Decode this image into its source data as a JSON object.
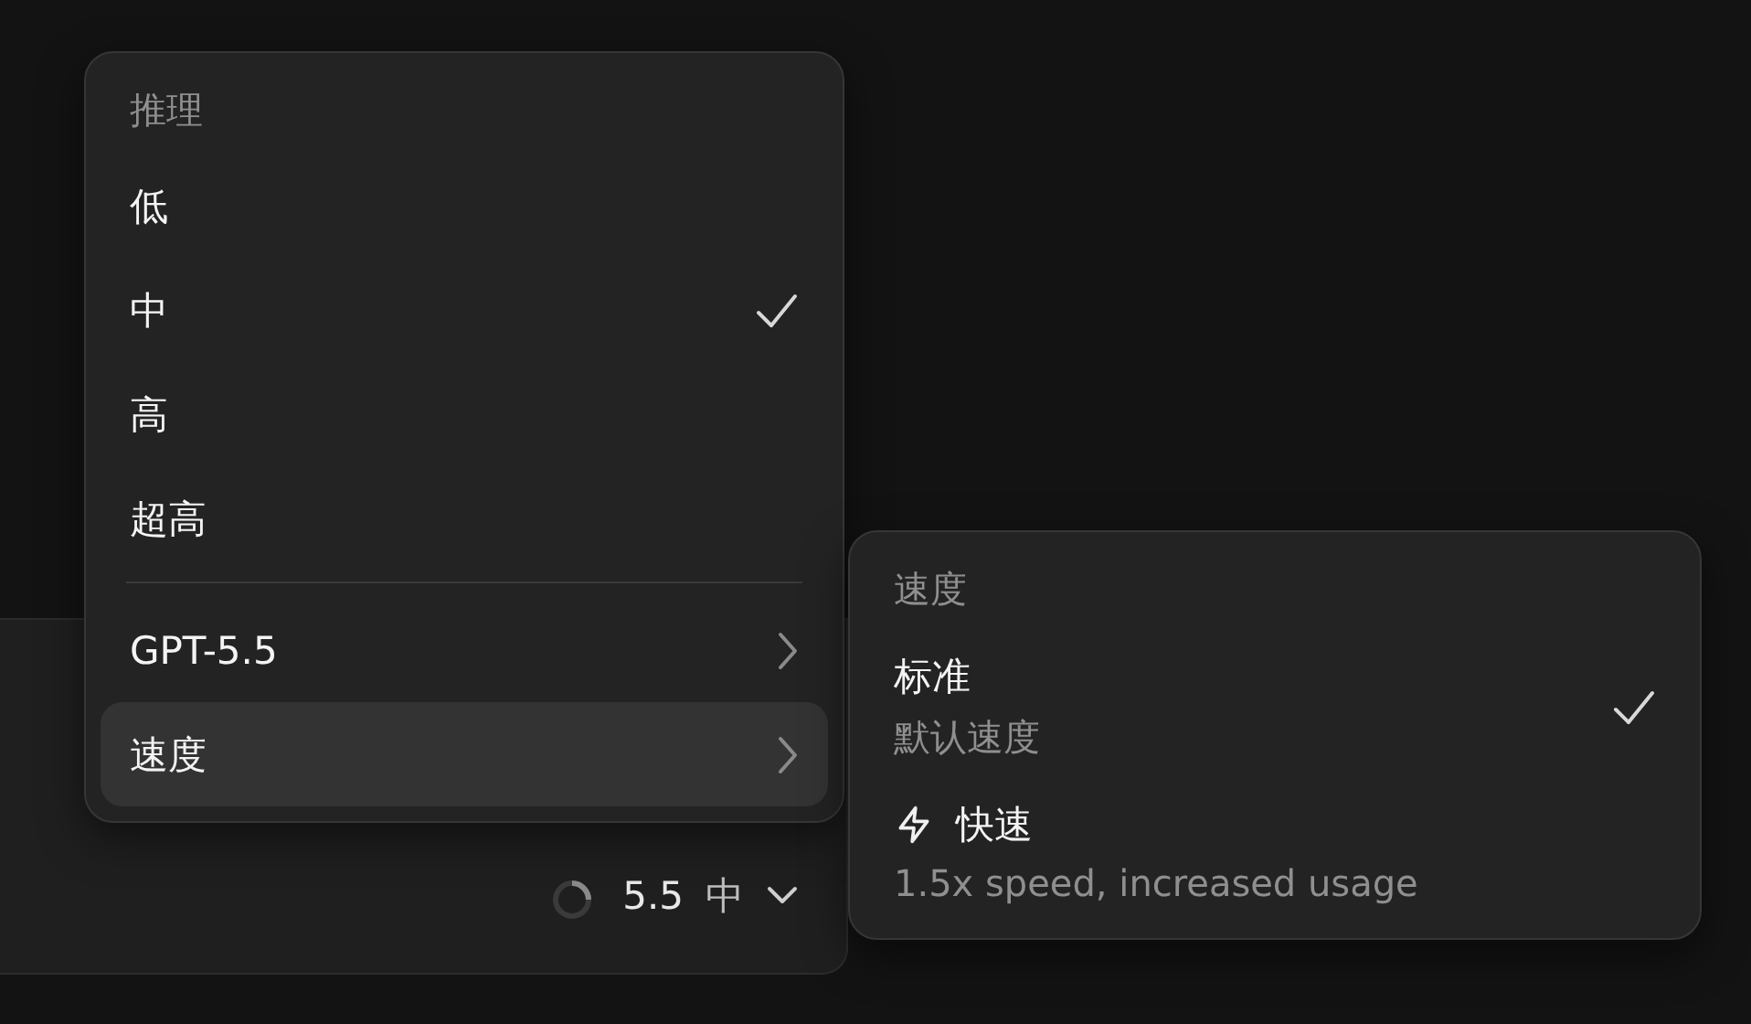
{
  "reasoning_menu": {
    "header": "推理",
    "items": [
      {
        "label": "低",
        "selected": false
      },
      {
        "label": "中",
        "selected": true
      },
      {
        "label": "高",
        "selected": false
      },
      {
        "label": "超高",
        "selected": false
      }
    ],
    "submenus": [
      {
        "label": "GPT-5.5",
        "highlighted": false
      },
      {
        "label": "速度",
        "highlighted": true
      }
    ]
  },
  "speed_menu": {
    "header": "速度",
    "options": [
      {
        "kind": "plain",
        "label": "标准",
        "description": "默认速度",
        "selected": true
      },
      {
        "kind": "bolt",
        "label": "快速",
        "description": "1.5x speed, increased usage",
        "selected": false
      }
    ]
  },
  "composer": {
    "model": "5.5",
    "effort": "中"
  }
}
